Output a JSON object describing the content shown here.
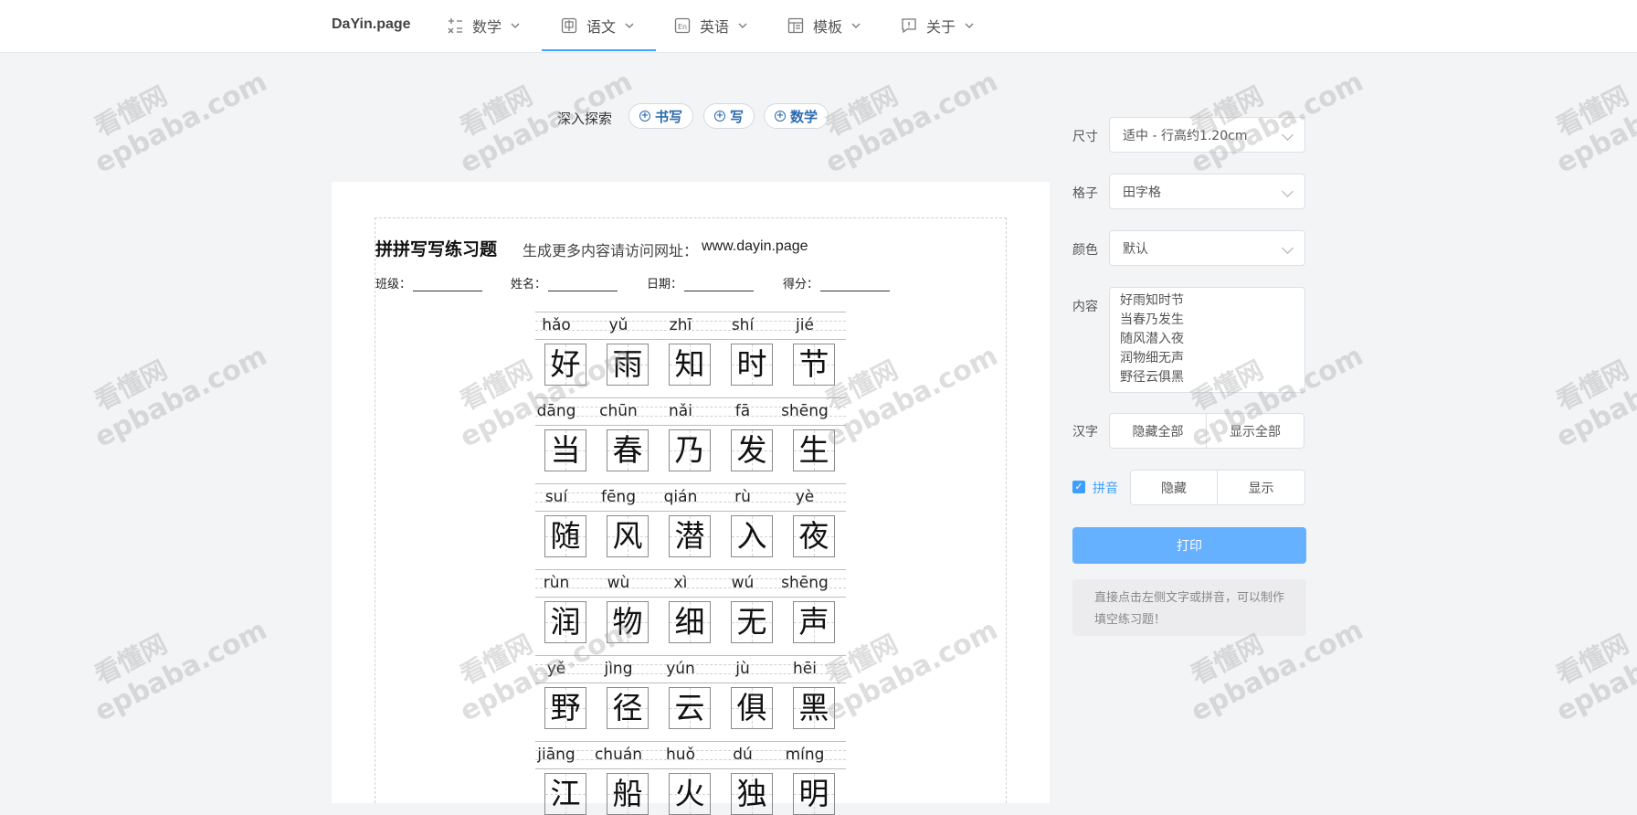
{
  "nav": {
    "brand": "DaYin.page",
    "items": [
      {
        "label": "数学",
        "icon": "math-icon"
      },
      {
        "label": "语文",
        "icon": "chinese-icon"
      },
      {
        "label": "英语",
        "icon": "english-icon"
      },
      {
        "label": "模板",
        "icon": "template-icon"
      },
      {
        "label": "关于",
        "icon": "about-icon"
      }
    ],
    "active": "语文"
  },
  "explore": {
    "label": "深入探索",
    "chips": [
      "书写",
      "写",
      "数学"
    ]
  },
  "sheet": {
    "title": "拼拼写写练习题",
    "subtitle": "生成更多内容请访问网址：",
    "url": "www.dayin.page",
    "fields": [
      "班级：",
      "姓名：",
      "日期：",
      "得分："
    ],
    "rows": [
      {
        "pinyin": [
          "hǎo",
          "yǔ",
          "zhī",
          "shí",
          "jié"
        ],
        "chars": [
          "好",
          "雨",
          "知",
          "时",
          "节"
        ]
      },
      {
        "pinyin": [
          "dāng",
          "chūn",
          "nǎi",
          "fā",
          "shēng"
        ],
        "chars": [
          "当",
          "春",
          "乃",
          "发",
          "生"
        ]
      },
      {
        "pinyin": [
          "suí",
          "fēng",
          "qián",
          "rù",
          "yè"
        ],
        "chars": [
          "随",
          "风",
          "潜",
          "入",
          "夜"
        ]
      },
      {
        "pinyin": [
          "rùn",
          "wù",
          "xì",
          "wú",
          "shēng"
        ],
        "chars": [
          "润",
          "物",
          "细",
          "无",
          "声"
        ]
      },
      {
        "pinyin": [
          "yě",
          "jìng",
          "yún",
          "jù",
          "hēi"
        ],
        "chars": [
          "野",
          "径",
          "云",
          "俱",
          "黑"
        ]
      },
      {
        "pinyin": [
          "jiāng",
          "chuán",
          "huǒ",
          "dú",
          "míng"
        ],
        "chars": [
          "江",
          "船",
          "火",
          "独",
          "明"
        ]
      }
    ]
  },
  "panel": {
    "size": {
      "label": "尺寸",
      "value": "适中 - 行高约1.20cm"
    },
    "grid": {
      "label": "格子",
      "value": "田字格"
    },
    "color": {
      "label": "颜色",
      "value": "默认"
    },
    "content": {
      "label": "内容",
      "lines": [
        "好雨知时节",
        "当春乃发生",
        "随风潜入夜",
        "润物细无声",
        "野径云俱黑"
      ]
    },
    "hanzi": {
      "label": "汉字",
      "buttons": [
        "隐藏全部",
        "显示全部"
      ]
    },
    "pinyin": {
      "label": "拼音",
      "checked": true,
      "buttons": [
        "隐藏",
        "显示"
      ]
    },
    "print": "打印",
    "tip": "直接点击左侧文字或拼音，可以制作填空练习题！"
  },
  "watermark": {
    "cn": "看懂网",
    "en": "epbaba.com"
  },
  "colors": {
    "accent": "#409eff",
    "print": "#66b1ff",
    "chip": "#2b6cb0"
  }
}
